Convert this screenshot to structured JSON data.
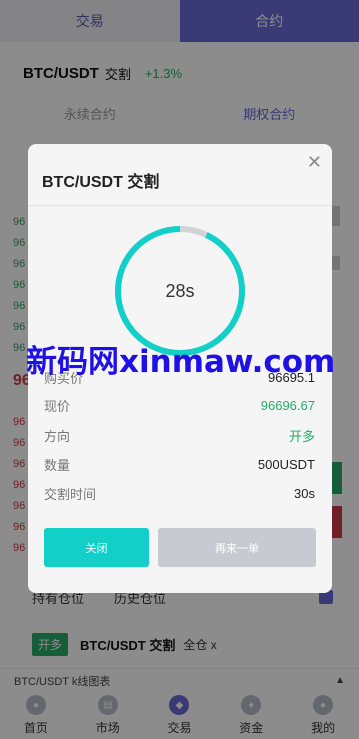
{
  "top_tabs": [
    "交易",
    "合约"
  ],
  "pair": {
    "name": "BTC/USDT",
    "suffix": "交割",
    "change": "+1.3%"
  },
  "sub_tabs": [
    "永续合约",
    "期权合约"
  ],
  "position_tabs": [
    "持有仓位",
    "历史仓位"
  ],
  "open_position": {
    "badge": "开多",
    "pair": "BTC/USDT 交割",
    "mode": "全仓 x"
  },
  "kline_label": "BTC/USDT k线图表",
  "bottom_nav": [
    {
      "label": "首页",
      "icon": "home-icon"
    },
    {
      "label": "市场",
      "icon": "market-icon"
    },
    {
      "label": "交易",
      "icon": "trade-icon"
    },
    {
      "label": "资金",
      "icon": "wallet-icon"
    },
    {
      "label": "我的",
      "icon": "user-icon"
    }
  ],
  "modal": {
    "title": "BTC/USDT 交割",
    "countdown": "28s",
    "countdown_fraction": 0.93,
    "rows": [
      {
        "label": "购买价",
        "value": "96695.1"
      },
      {
        "label": "现价",
        "value": "96696.67"
      },
      {
        "label": "方向",
        "value": "开多"
      },
      {
        "label": "数量",
        "value": "500USDT"
      },
      {
        "label": "交割时间",
        "value": "30s"
      }
    ],
    "close_button": "关闭",
    "again_button": "再来一单"
  },
  "watermark": "新码网xinmaw.com",
  "colors": {
    "accent": "#6a6ad8",
    "teal": "#12d0c8",
    "green": "#28a96b",
    "red": "#d23a4a",
    "watermark": "#1f10e6"
  }
}
